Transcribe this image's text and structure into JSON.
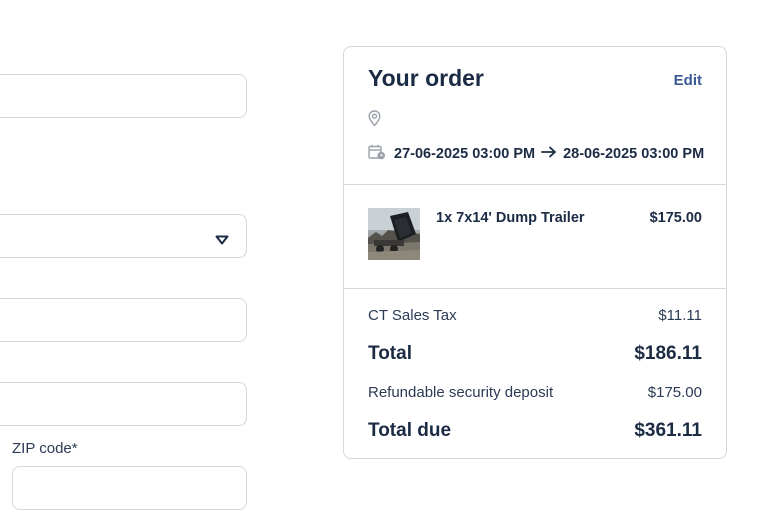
{
  "form": {
    "zip_label": "ZIP code*",
    "fields": [
      {
        "name": "form-field-1",
        "value": ""
      },
      {
        "name": "form-field-select",
        "value": ""
      },
      {
        "name": "form-field-3",
        "value": ""
      },
      {
        "name": "form-field-4",
        "value": ""
      },
      {
        "name": "zip-code-field",
        "value": ""
      }
    ]
  },
  "order": {
    "title": "Your order",
    "edit_label": "Edit",
    "start": "27-06-2025 03:00 PM",
    "end": "28-06-2025 03:00 PM",
    "item": {
      "name": "1x 7x14' Dump Trailer",
      "price": "$175.00"
    },
    "tax_label": "CT Sales Tax",
    "tax_value": "$11.11",
    "total_label": "Total",
    "total_value": "$186.11",
    "deposit_label": "Refundable security deposit",
    "deposit_value": "$175.00",
    "due_label": "Total due",
    "due_value": "$361.11"
  },
  "icons": {
    "location": "map-pin-icon",
    "calendar": "calendar-clock-icon",
    "arrow": "arrow-right-icon",
    "caret": "caret-down-icon"
  },
  "colors": {
    "text": "#1b2b44",
    "link": "#3a5a96",
    "border": "#d3d7de"
  }
}
